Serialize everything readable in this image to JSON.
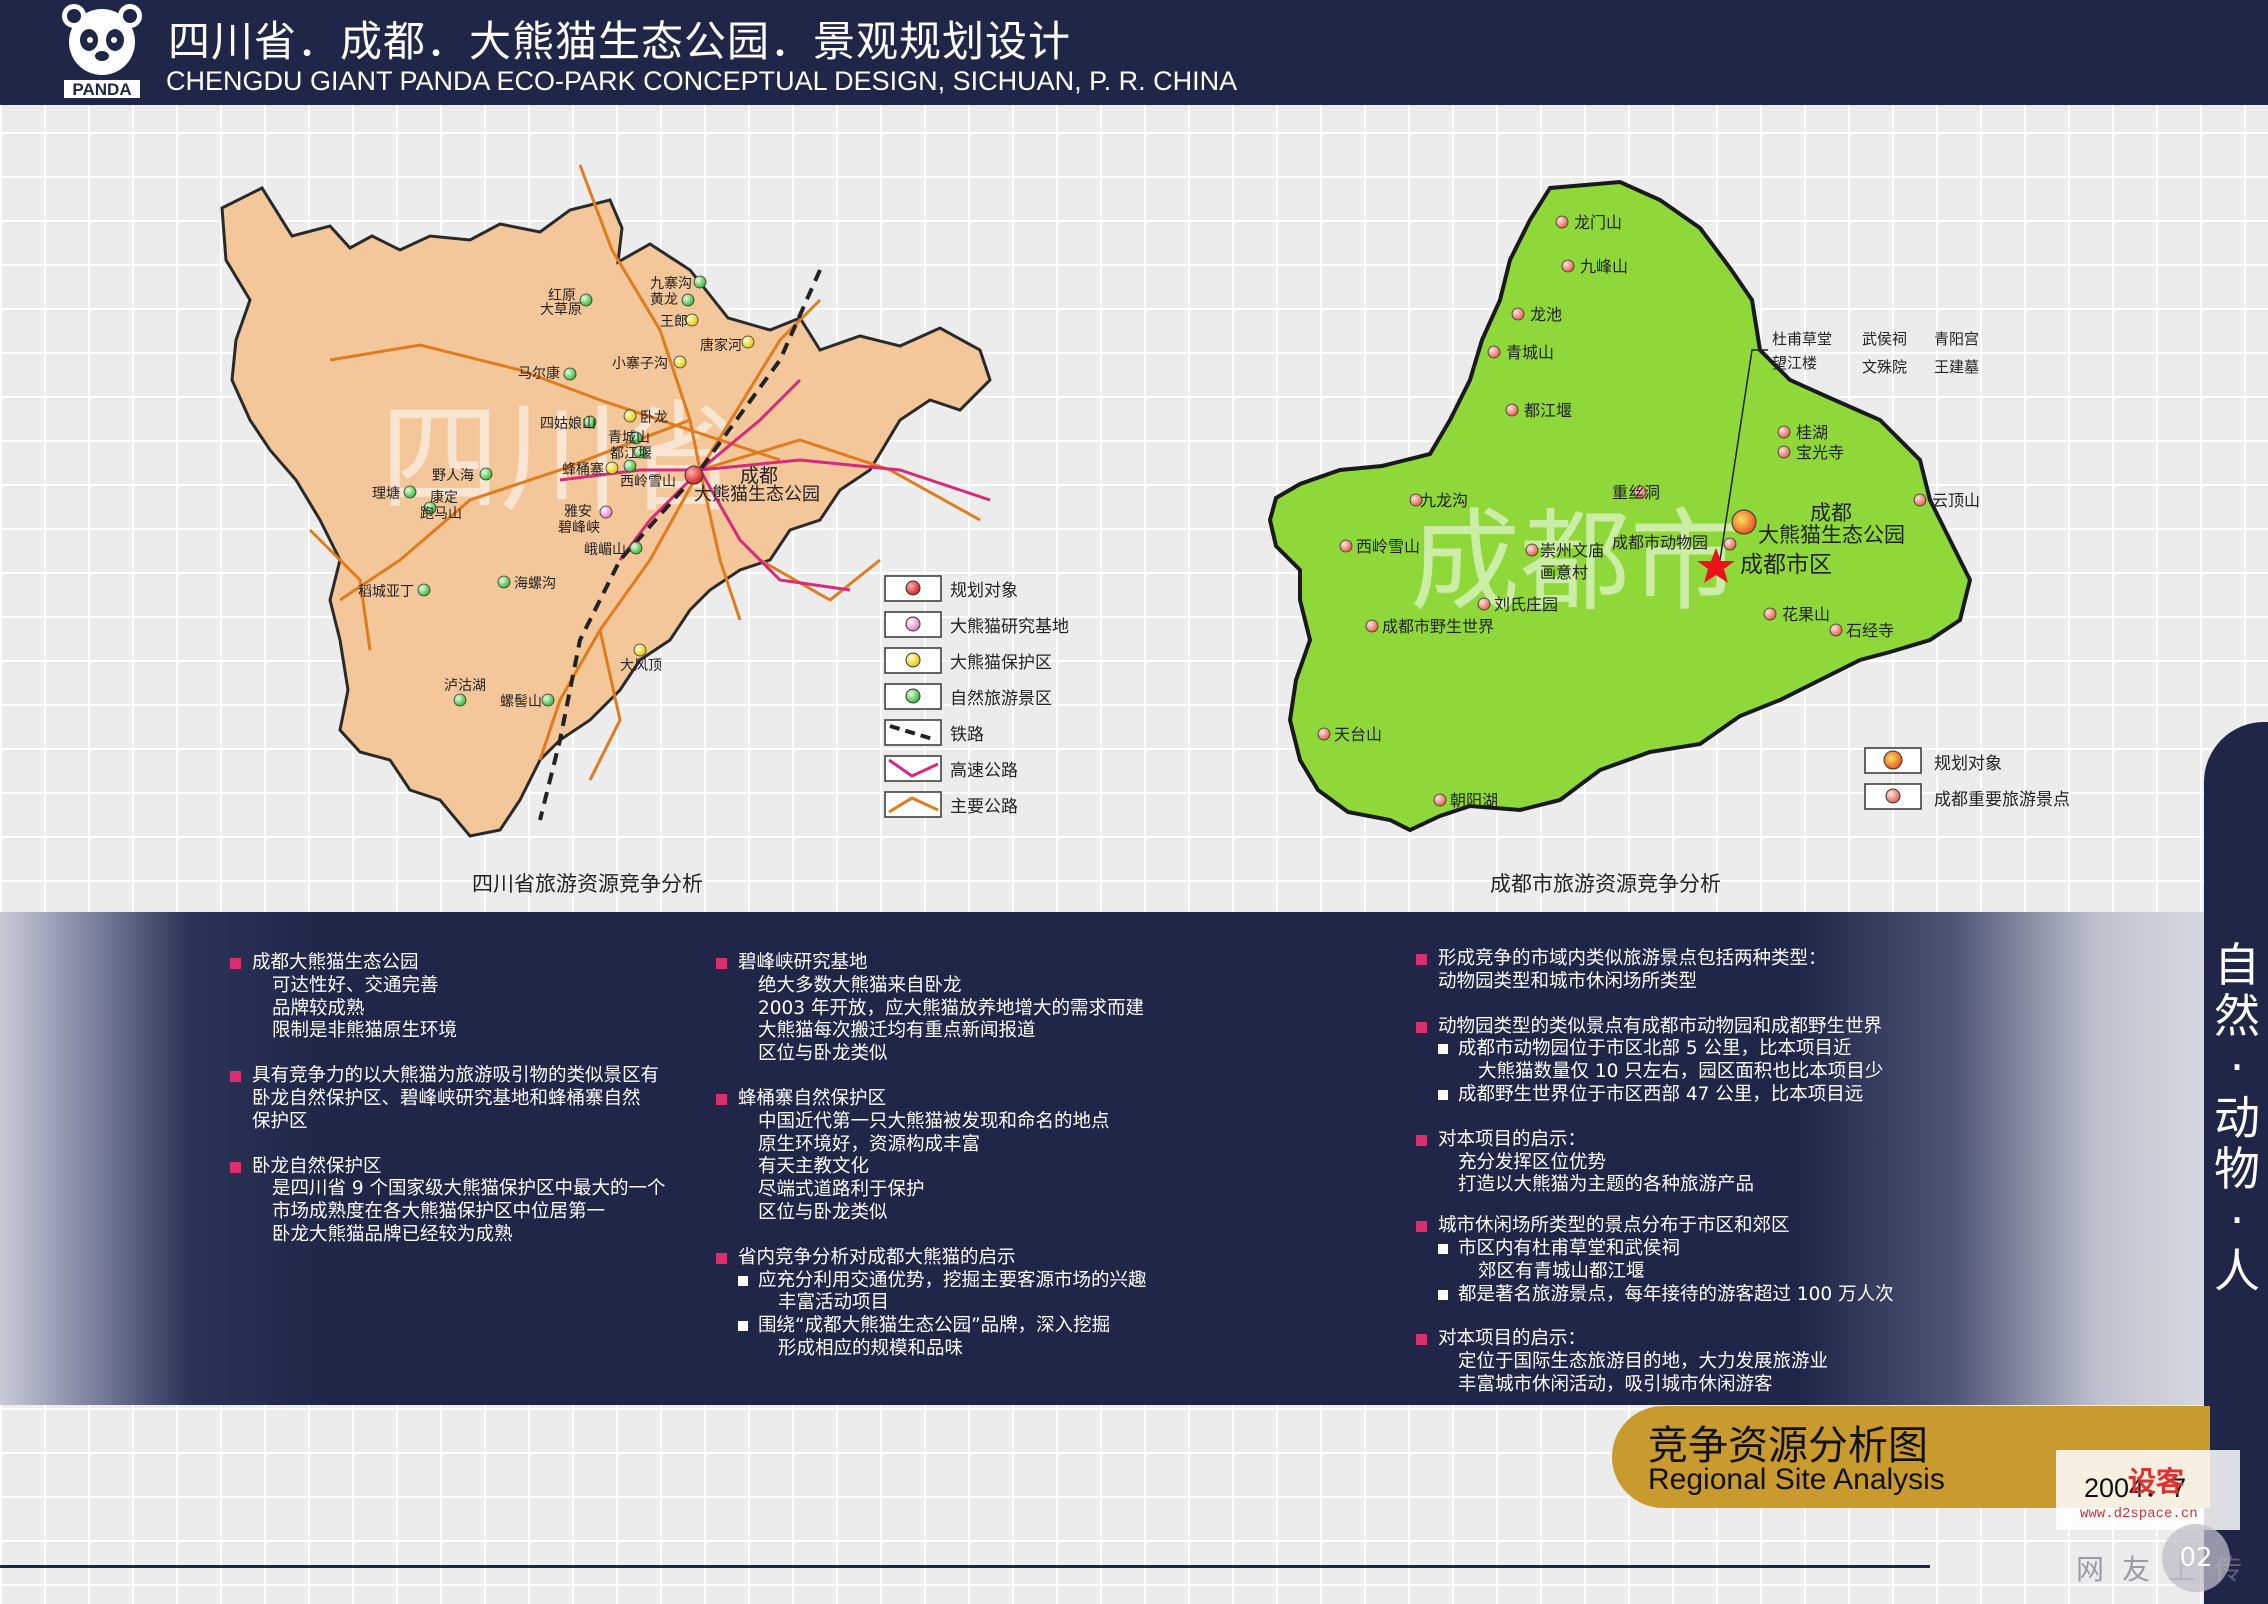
{
  "header": {
    "title_cn": "四川省．成都．大熊猫生态公园．景观规划设计",
    "title_en": "CHENGDU GIANT PANDA ECO-PARK CONCEPTUAL DESIGN, SICHUAN, P. R. CHINA",
    "logo_text": "PANDA"
  },
  "sichuan_map": {
    "watermark": "四川省",
    "caption": "四川省旅游资源竞争分析",
    "chengdu_label": "成都",
    "park_label": "大熊猫生态公园",
    "places": [
      {
        "label": "九寨沟",
        "kind": "scenic"
      },
      {
        "label": "黄龙",
        "kind": "scenic"
      },
      {
        "label": "王郎",
        "kind": "reserve"
      },
      {
        "label": "唐家河",
        "kind": "reserve"
      },
      {
        "label": "红原",
        "kind": "scenic"
      },
      {
        "label": "大草原",
        "kind": "scenic"
      },
      {
        "label": "小寨子沟",
        "kind": "reserve"
      },
      {
        "label": "马尔康",
        "kind": "scenic"
      },
      {
        "label": "四姑娘山",
        "kind": "scenic"
      },
      {
        "label": "卧龙",
        "kind": "reserve"
      },
      {
        "label": "青城山",
        "kind": "scenic"
      },
      {
        "label": "都江堰",
        "kind": "scenic"
      },
      {
        "label": "蜂桶寨",
        "kind": "reserve"
      },
      {
        "label": "西岭雪山",
        "kind": "scenic"
      },
      {
        "label": "野人海",
        "kind": "scenic"
      },
      {
        "label": "理塘",
        "kind": "scenic"
      },
      {
        "label": "康定",
        "kind": "scenic"
      },
      {
        "label": "跑马山",
        "kind": "scenic"
      },
      {
        "label": "雅安",
        "kind": "research"
      },
      {
        "label": "碧峰峡",
        "kind": "research"
      },
      {
        "label": "峨嵋山",
        "kind": "scenic"
      },
      {
        "label": "海螺沟",
        "kind": "scenic"
      },
      {
        "label": "稻城亚丁",
        "kind": "scenic"
      },
      {
        "label": "大风顶",
        "kind": "reserve"
      },
      {
        "label": "泸沽湖",
        "kind": "scenic"
      },
      {
        "label": "螺髻山",
        "kind": "scenic"
      }
    ],
    "legend": [
      {
        "label": "规划对象",
        "symbol": "red-dot"
      },
      {
        "label": "大熊猫研究基地",
        "symbol": "pink-dot"
      },
      {
        "label": "大熊猫保护区",
        "symbol": "yellow-dot"
      },
      {
        "label": "自然旅游景区",
        "symbol": "green-dot"
      },
      {
        "label": "铁路",
        "symbol": "railway-line"
      },
      {
        "label": "高速公路",
        "symbol": "expressway-line"
      },
      {
        "label": "主要公路",
        "symbol": "highway-line"
      }
    ],
    "colors": {
      "land": "#f3c79a",
      "border": "#2a2a2a",
      "expressway": "#d62a7a",
      "highway": "#e07b1e"
    }
  },
  "chengdu_map": {
    "watermark": "成都市",
    "caption": "成都市旅游资源竞争分析",
    "chengdu_label": "成都",
    "park_label": "大熊猫生态公园",
    "urban_label": "成都市区",
    "zoo_label": "成都市动物园",
    "places": [
      "龙门山",
      "九峰山",
      "龙池",
      "青城山",
      "都江堰",
      "九龙沟",
      "西岭雪山",
      "成都市野生世界",
      "天台山",
      "朝阳湖",
      "重丝洞",
      "崇州文庙",
      "画意村",
      "刘氏庄园",
      "桂湖",
      "宝光寺",
      "云顶山",
      "花果山",
      "石经寺"
    ],
    "urban_sites": [
      "杜甫草堂",
      "武侯祠",
      "青阳宫",
      "望江楼",
      "文殊院",
      "王建墓"
    ],
    "legend": [
      {
        "label": "规划对象",
        "symbol": "orange-dot"
      },
      {
        "label": "成都重要旅游景点",
        "symbol": "salmon-dot"
      }
    ],
    "colors": {
      "land": "#8fd83a",
      "border": "#1a1a1a"
    }
  },
  "analysis": {
    "col1": [
      {
        "head": "成都大熊猫生态公园",
        "lines": [
          "可达性好、交通完善",
          "品牌较成熟",
          "限制是非熊猫原生环境"
        ]
      },
      {
        "head": "具有竞争力的以大熊猫为旅游吸引物的类似景区有",
        "cont": [
          "卧龙自然保护区、碧峰峡研究基地和蜂桶寨自然",
          "保护区"
        ]
      },
      {
        "head": "卧龙自然保护区",
        "lines": [
          "是四川省 9 个国家级大熊猫保护区中最大的一个",
          "市场成熟度在各大熊猫保护区中位居第一",
          "卧龙大熊猫品牌已经较为成熟"
        ]
      }
    ],
    "col2": [
      {
        "head": "碧峰峡研究基地",
        "lines": [
          "绝大多数大熊猫来自卧龙",
          "2003 年开放，应大熊猫放养地增大的需求而建",
          "大熊猫每次搬迁均有重点新闻报道",
          "区位与卧龙类似"
        ]
      },
      {
        "head": "蜂桶寨自然保护区",
        "lines": [
          "中国近代第一只大熊猫被发现和命名的地点",
          "原生环境好，资源构成丰富",
          "有天主教文化",
          "尽端式道路利于保护",
          "区位与卧龙类似"
        ]
      },
      {
        "head": "省内竞争分析对成都大熊猫的启示",
        "subs": [
          {
            "text": "应充分利用交通优势，挖掘主要客源市场的兴趣",
            "cont": [
              "丰富活动项目"
            ]
          },
          {
            "text": "围绕“成都大熊猫生态公园”品牌，深入挖掘",
            "cont": [
              "形成相应的规模和品味"
            ]
          }
        ]
      }
    ],
    "col3": [
      {
        "head": "形成竞争的市域内类似旅游景点包括两种类型：",
        "cont": [
          "动物园类型和城市休闲场所类型"
        ]
      },
      {
        "head": "动物园类型的类似景点有成都市动物园和成都野生世界",
        "subs": [
          {
            "text": "成都市动物园位于市区北部 5 公里，比本项目近",
            "cont": [
              "大熊猫数量仅 10 只左右，园区面积也比本项目少"
            ]
          },
          {
            "text": "成都野生世界位于市区西部 47 公里，比本项目远",
            "cont": []
          }
        ]
      },
      {
        "head": "对本项目的启示：",
        "lines": [
          "充分发挥区位优势",
          "打造以大熊猫为主题的各种旅游产品"
        ],
        "tight": true
      },
      {
        "head": "城市休闲场所类型的景点分布于市区和郊区",
        "subs": [
          {
            "text": "市区内有杜甫草堂和武侯祠",
            "cont": [
              "郊区有青城山都江堰"
            ]
          },
          {
            "text": "都是著名旅游景点，每年接待的游客超过 100 万人次",
            "cont": []
          }
        ]
      },
      {
        "head": "对本项目的启示：",
        "lines": [
          "定位于国际生态旅游目的地，大力发展旅游业",
          "丰富城市休闲活动，吸引城市休闲游客"
        ],
        "tight": true
      }
    ]
  },
  "sidebar": {
    "text": "自\n然\n·\n动\n物\n·\n人"
  },
  "footer": {
    "title_cn": "竞争资源分析图",
    "title_en": "Regional Site Analysis",
    "year": "2004．7",
    "watermark_cn": "设客",
    "watermark_url": "www.d2space.cn",
    "watermark_net": "网友上传",
    "page_no": "02"
  }
}
